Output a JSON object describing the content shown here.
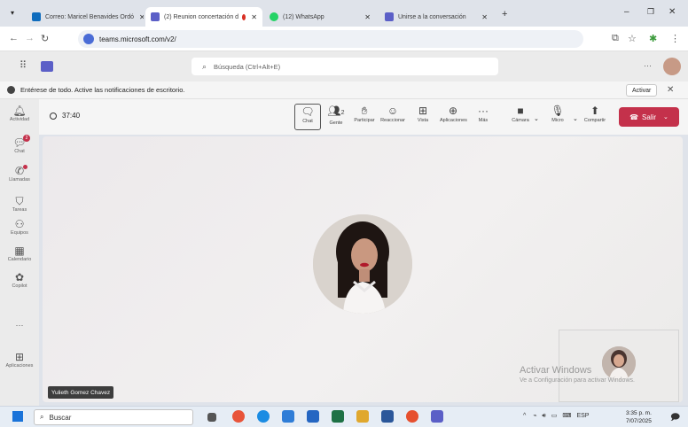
{
  "browser": {
    "tabs": [
      {
        "label": "Correo: Maricel Benavides Ordó",
        "favicon_color": "#0f6cbd"
      },
      {
        "label": "(2) Reunion concertación d",
        "favicon_color": "#5b5fc7",
        "active": true
      },
      {
        "label": "(12) WhatsApp",
        "favicon_color": "#25d366"
      },
      {
        "label": "Unirse a la conversación",
        "favicon_color": "#5b5fc7"
      }
    ],
    "url": "teams.microsoft.com/v2/"
  },
  "teams": {
    "search_placeholder": "Búsqueda (Ctrl+Alt+E)",
    "notification": {
      "text": "Entérese de todo. Active las notificaciones de escritorio.",
      "button": "Activar"
    },
    "sidebar": [
      {
        "label": "Actividad",
        "icon": "bell-icon"
      },
      {
        "label": "Chat",
        "icon": "chat-icon",
        "badge": "2"
      },
      {
        "label": "Llamadas",
        "icon": "phone-icon"
      },
      {
        "label": "Tareas",
        "icon": "tasks-icon"
      },
      {
        "label": "Equipos",
        "icon": "teams-icon"
      },
      {
        "label": "Calendario",
        "icon": "calendar-icon"
      },
      {
        "label": "Copilot",
        "icon": "copilot-icon"
      },
      {
        "label": "",
        "icon": "more-icon"
      },
      {
        "label": "Aplicaciones",
        "icon": "apps-icon"
      }
    ],
    "meeting": {
      "timer": "37:40",
      "participants_count": "2",
      "toolbar": {
        "chat": "Chat",
        "people": "Gente",
        "raise": "Participar",
        "react": "Reaccionar",
        "view": "Vista",
        "apps": "Aplicaciones",
        "more": "Más",
        "camera": "Cámara",
        "mic": "Micro",
        "share": "Compartir",
        "leave": "Salir"
      },
      "participant_name": "Yulieth Gomez Chavez"
    },
    "watermark": {
      "title": "Activar Windows",
      "subtitle": "Ve a Configuración para activar Windows."
    }
  },
  "taskbar": {
    "search": "Buscar",
    "lang": "ESP",
    "time": "3:35 p. m.",
    "date": "7/07/2025"
  }
}
